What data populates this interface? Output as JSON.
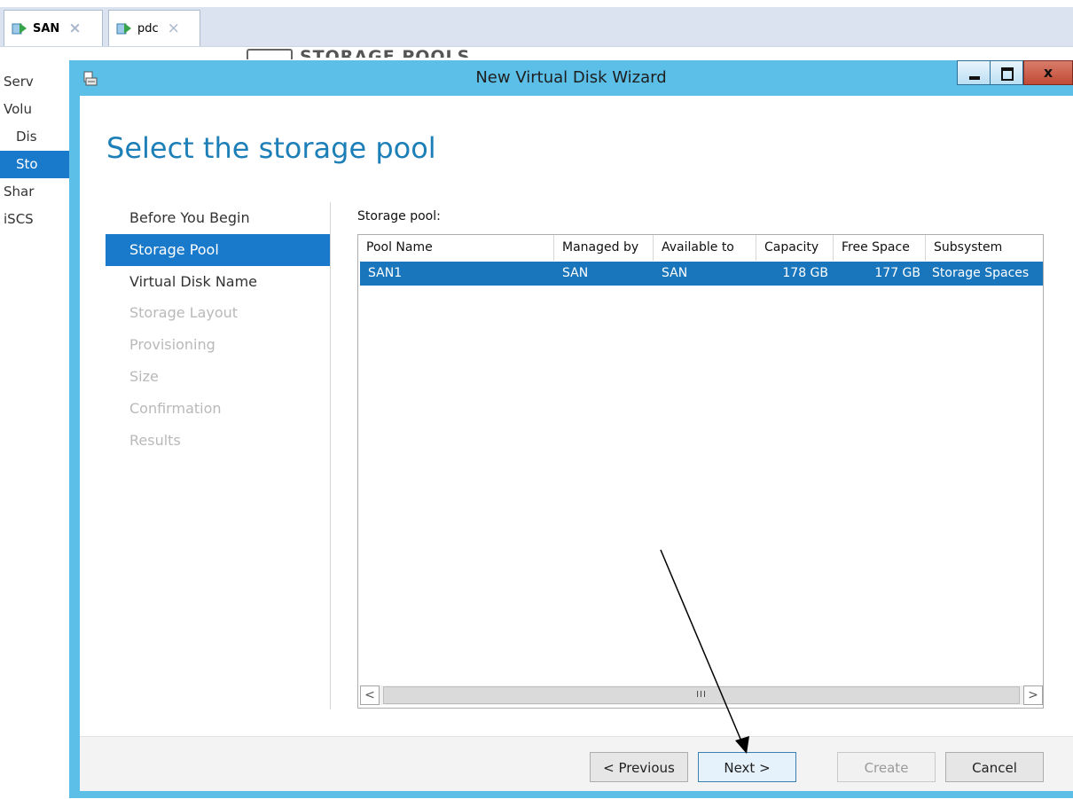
{
  "tabs": [
    {
      "label": "SAN",
      "close": "×",
      "active": true
    },
    {
      "label": "pdc",
      "close": "×",
      "active": false
    }
  ],
  "background_nav": [
    "Serv",
    "Volu",
    "Dis",
    "Sto",
    "Shar",
    "iSCS"
  ],
  "background_header": "STORAGE POOLS",
  "wizard": {
    "title": "New Virtual Disk Wizard",
    "page_title": "Select the storage pool",
    "steps": [
      {
        "label": "Before You Begin",
        "state": "done"
      },
      {
        "label": "Storage Pool",
        "state": "active"
      },
      {
        "label": "Virtual Disk Name",
        "state": "enabled"
      },
      {
        "label": "Storage Layout",
        "state": "disabled"
      },
      {
        "label": "Provisioning",
        "state": "disabled"
      },
      {
        "label": "Size",
        "state": "disabled"
      },
      {
        "label": "Confirmation",
        "state": "disabled"
      },
      {
        "label": "Results",
        "state": "disabled"
      }
    ],
    "pool_label": "Storage pool:",
    "columns": [
      "Pool Name",
      "Managed by",
      "Available to",
      "Capacity",
      "Free Space",
      "Subsystem"
    ],
    "rows": [
      {
        "pool_name": "SAN1",
        "managed_by": "SAN",
        "available_to": "SAN",
        "capacity": "178 GB",
        "free_space": "177 GB",
        "subsystem": "Storage Spaces",
        "selected": true
      }
    ],
    "scroll_left": "<",
    "scroll_right": ">",
    "scroll_thumb": "III",
    "buttons": {
      "previous": "< Previous",
      "next": "Next >",
      "create": "Create",
      "cancel": "Cancel"
    }
  },
  "colors": {
    "selection_blue": "#1979ca",
    "title_accent": "#1d7fb8",
    "dialog_frame": "#5cbfe8",
    "close_red": "#c14a36"
  }
}
